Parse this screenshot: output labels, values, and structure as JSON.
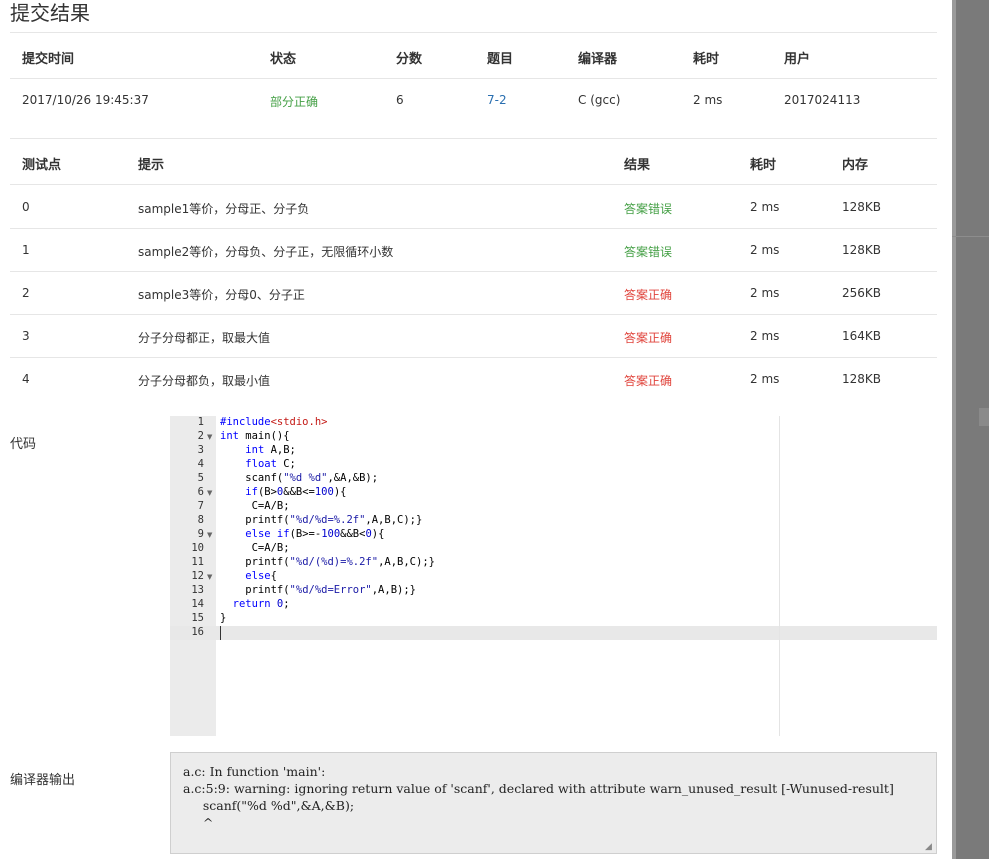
{
  "title": "提交结果",
  "submission": {
    "headers": [
      "提交时间",
      "状态",
      "分数",
      "题目",
      "编译器",
      "耗时",
      "用户"
    ],
    "row": {
      "time": "2017/10/26 19:45:37",
      "status": "部分正确",
      "score": "6",
      "problem": "7-2",
      "compiler": "C (gcc)",
      "elapsed": "2 ms",
      "user": "2017024113"
    }
  },
  "tests": {
    "headers": [
      "测试点",
      "提示",
      "结果",
      "耗时",
      "内存"
    ],
    "rows": [
      {
        "id": "0",
        "hint": "sample1等价，分母正、分子负",
        "result": "答案错误",
        "status": "wrong",
        "time": "2 ms",
        "memory": "128KB"
      },
      {
        "id": "1",
        "hint": "sample2等价，分母负、分子正，无限循环小数",
        "result": "答案错误",
        "status": "wrong",
        "time": "2 ms",
        "memory": "128KB"
      },
      {
        "id": "2",
        "hint": "sample3等价，分母0、分子正",
        "result": "答案正确",
        "status": "correct",
        "time": "2 ms",
        "memory": "256KB"
      },
      {
        "id": "3",
        "hint": "分子分母都正，取最大值",
        "result": "答案正确",
        "status": "correct",
        "time": "2 ms",
        "memory": "164KB"
      },
      {
        "id": "4",
        "hint": "分子分母都负，取最小值",
        "result": "答案正确",
        "status": "correct",
        "time": "2 ms",
        "memory": "128KB"
      }
    ]
  },
  "code_label": "代码",
  "code_lines": [
    "#include<stdio.h>",
    "int main(){",
    "    int A,B;",
    "    float C;",
    "    scanf(\"%d %d\",&A,&B);",
    "    if(B>0&&B<=100){",
    "     C=A/B;",
    "    printf(\"%d/%d=%.2f\",A,B,C);}",
    "    else if(B>=-100&&B<0){",
    "     C=A/B;",
    "    printf(\"%d/(%d)=%.2f\",A,B,C);}",
    "    else{",
    "    printf(\"%d/%d=Error\",A,B);}",
    "  return 0;",
    "}",
    ""
  ],
  "fold_lines": [
    2,
    6,
    9,
    12
  ],
  "compiler_label": "编译器输出",
  "compiler_output": "a.c: In function 'main':\na.c:5:9: warning: ignoring return value of 'scanf', declared with attribute warn_unused_result [-Wunused-result]\n     scanf(\"%d %d\",&A,&B);\n     ^",
  "colors": {
    "correct": "#e0433b",
    "wrong": "#45a046",
    "partial": "#45a046",
    "link": "#2a6fb0"
  }
}
